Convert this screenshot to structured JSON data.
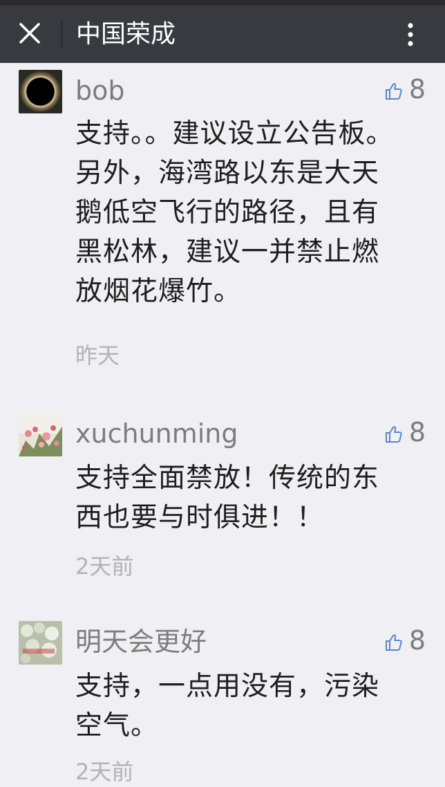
{
  "header": {
    "title": "中国荣成",
    "close_icon": "close-icon",
    "more_icon": "more-vertical-icon",
    "background": "#393a3f"
  },
  "comments": [
    {
      "nickname": "bob",
      "likes": "8",
      "content": "支持。。建议设立公告板。另外，海湾路以东是大天鹅低空飞行的路径，且有黑松林，建议一并禁止燃放烟花爆竹。",
      "time": "昨天",
      "avatar": "eclipse-avatar"
    },
    {
      "nickname": "xuchunming",
      "likes": "8",
      "content": "支持全面禁放！传统的东西也要与时俱进！！",
      "time": "2天前",
      "avatar": "flower-avatar"
    },
    {
      "nickname": "明天会更好",
      "likes": "8",
      "content": "支持，一点用没有，污染空气。",
      "time": "2天前",
      "avatar": "blossom-avatar"
    }
  ],
  "colors": {
    "nickname": "#7d7d7d",
    "content": "#1e1e1e",
    "time": "#b3b3b3",
    "like_icon": "#5a86c4"
  }
}
